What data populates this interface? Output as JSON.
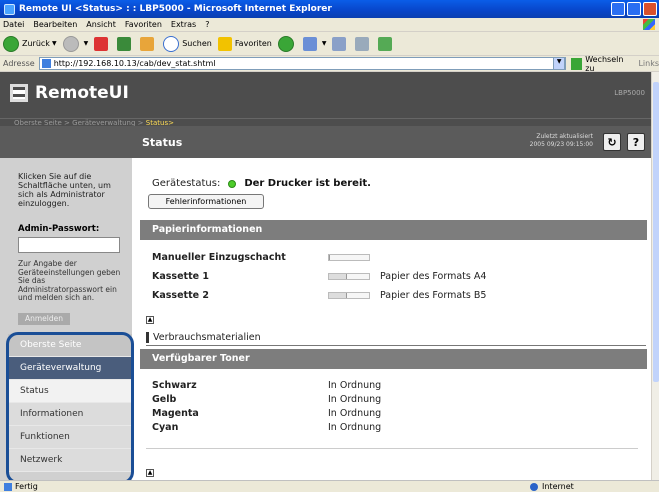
{
  "window": {
    "title": "Remote UI <Status> : : LBP5000 - Microsoft Internet Explorer"
  },
  "menubar": [
    "Datei",
    "Bearbeiten",
    "Ansicht",
    "Favoriten",
    "Extras",
    "?"
  ],
  "toolbar": {
    "back": "Zurück",
    "search": "Suchen",
    "favorites": "Favoriten"
  },
  "addressbar": {
    "label": "Adresse",
    "url": "http://192.168.10.13/cab/dev_stat.shtml",
    "go": "Wechseln zu",
    "links": "Links"
  },
  "app": {
    "logo": "RemoteUI",
    "model": "LBP5000",
    "breadcrumb": {
      "part1": "Oberste Seite",
      "sep1": " > ",
      "part2": "Geräteverwaltung",
      "sep2": " > ",
      "current": "Status>"
    },
    "page_title": "Status",
    "updated_label": "Zuletzt aktualisiert",
    "updated_time": "2005 09/23 09:15:00"
  },
  "login": {
    "intro": "Klicken Sie auf die Schaltfläche unten, um sich als Administrator einzuloggen.",
    "password_label": "Admin-Passwort:",
    "note": "Zur Angabe der Geräteeinstellungen geben Sie das Administratorpasswort ein und melden sich an.",
    "button": "Anmelden"
  },
  "nav": {
    "top": "Oberste Seite",
    "management": "Geräteverwaltung",
    "items": [
      "Status",
      "Informationen",
      "Funktionen",
      "Netzwerk"
    ]
  },
  "main": {
    "device_status_label": "Gerätestatus:",
    "device_status_value": "Der Drucker ist bereit.",
    "error_button": "Fehlerinformationen",
    "paper_section": "Papierinformationen",
    "paper_rows": [
      {
        "name": "Manueller Einzugschacht",
        "level": 0,
        "info": ""
      },
      {
        "name": "Kassette 1",
        "level": 0.45,
        "info": "Papier des Formats A4"
      },
      {
        "name": "Kassette 2",
        "level": 0.45,
        "info": "Papier des Formats B5"
      }
    ],
    "consumables_heading": "Verbrauchsmaterialien",
    "toner_section": "Verfügbarer Toner",
    "toner_rows": [
      {
        "color": "Schwarz",
        "state": "In Ordnung"
      },
      {
        "color": "Gelb",
        "state": "In Ordnung"
      },
      {
        "color": "Magenta",
        "state": "In Ordnung"
      },
      {
        "color": "Cyan",
        "state": "In Ordnung"
      }
    ]
  },
  "statusbar": {
    "ready": "Fertig",
    "zone": "Internet"
  },
  "colors": {
    "header_bg": "#4d4d4d",
    "section_bar": "#7d7d7d",
    "nav_selected_group": "#4a5d7c",
    "status_led": "#4dcc2a",
    "highlight_ring": "#1a4e96"
  }
}
